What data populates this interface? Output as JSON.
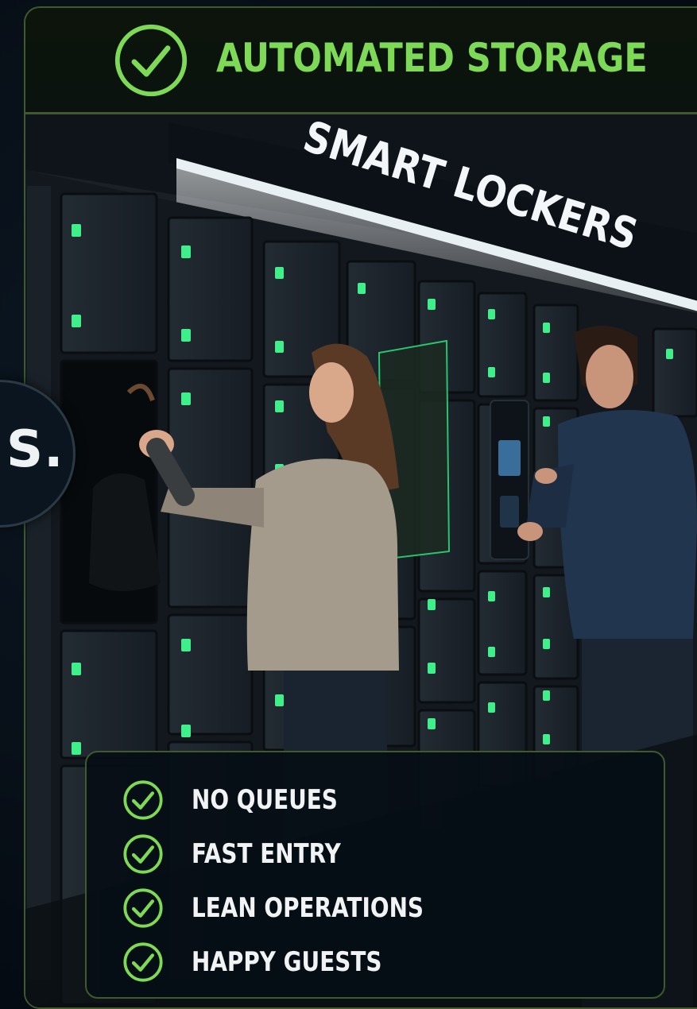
{
  "header": {
    "title": "AUTOMATED STORAGE",
    "accent_color": "#7ed957",
    "icon": "check-circle-icon"
  },
  "side_badge": {
    "text": "S."
  },
  "scene": {
    "sign_text": "SMART LOCKERS",
    "led_color": "#3ff08a"
  },
  "benefits": {
    "icon": "check-circle-icon",
    "items": [
      {
        "label": "NO QUEUES"
      },
      {
        "label": "FAST ENTRY"
      },
      {
        "label": "LEAN OPERATIONS"
      },
      {
        "label": "HAPPY GUESTS"
      }
    ]
  }
}
